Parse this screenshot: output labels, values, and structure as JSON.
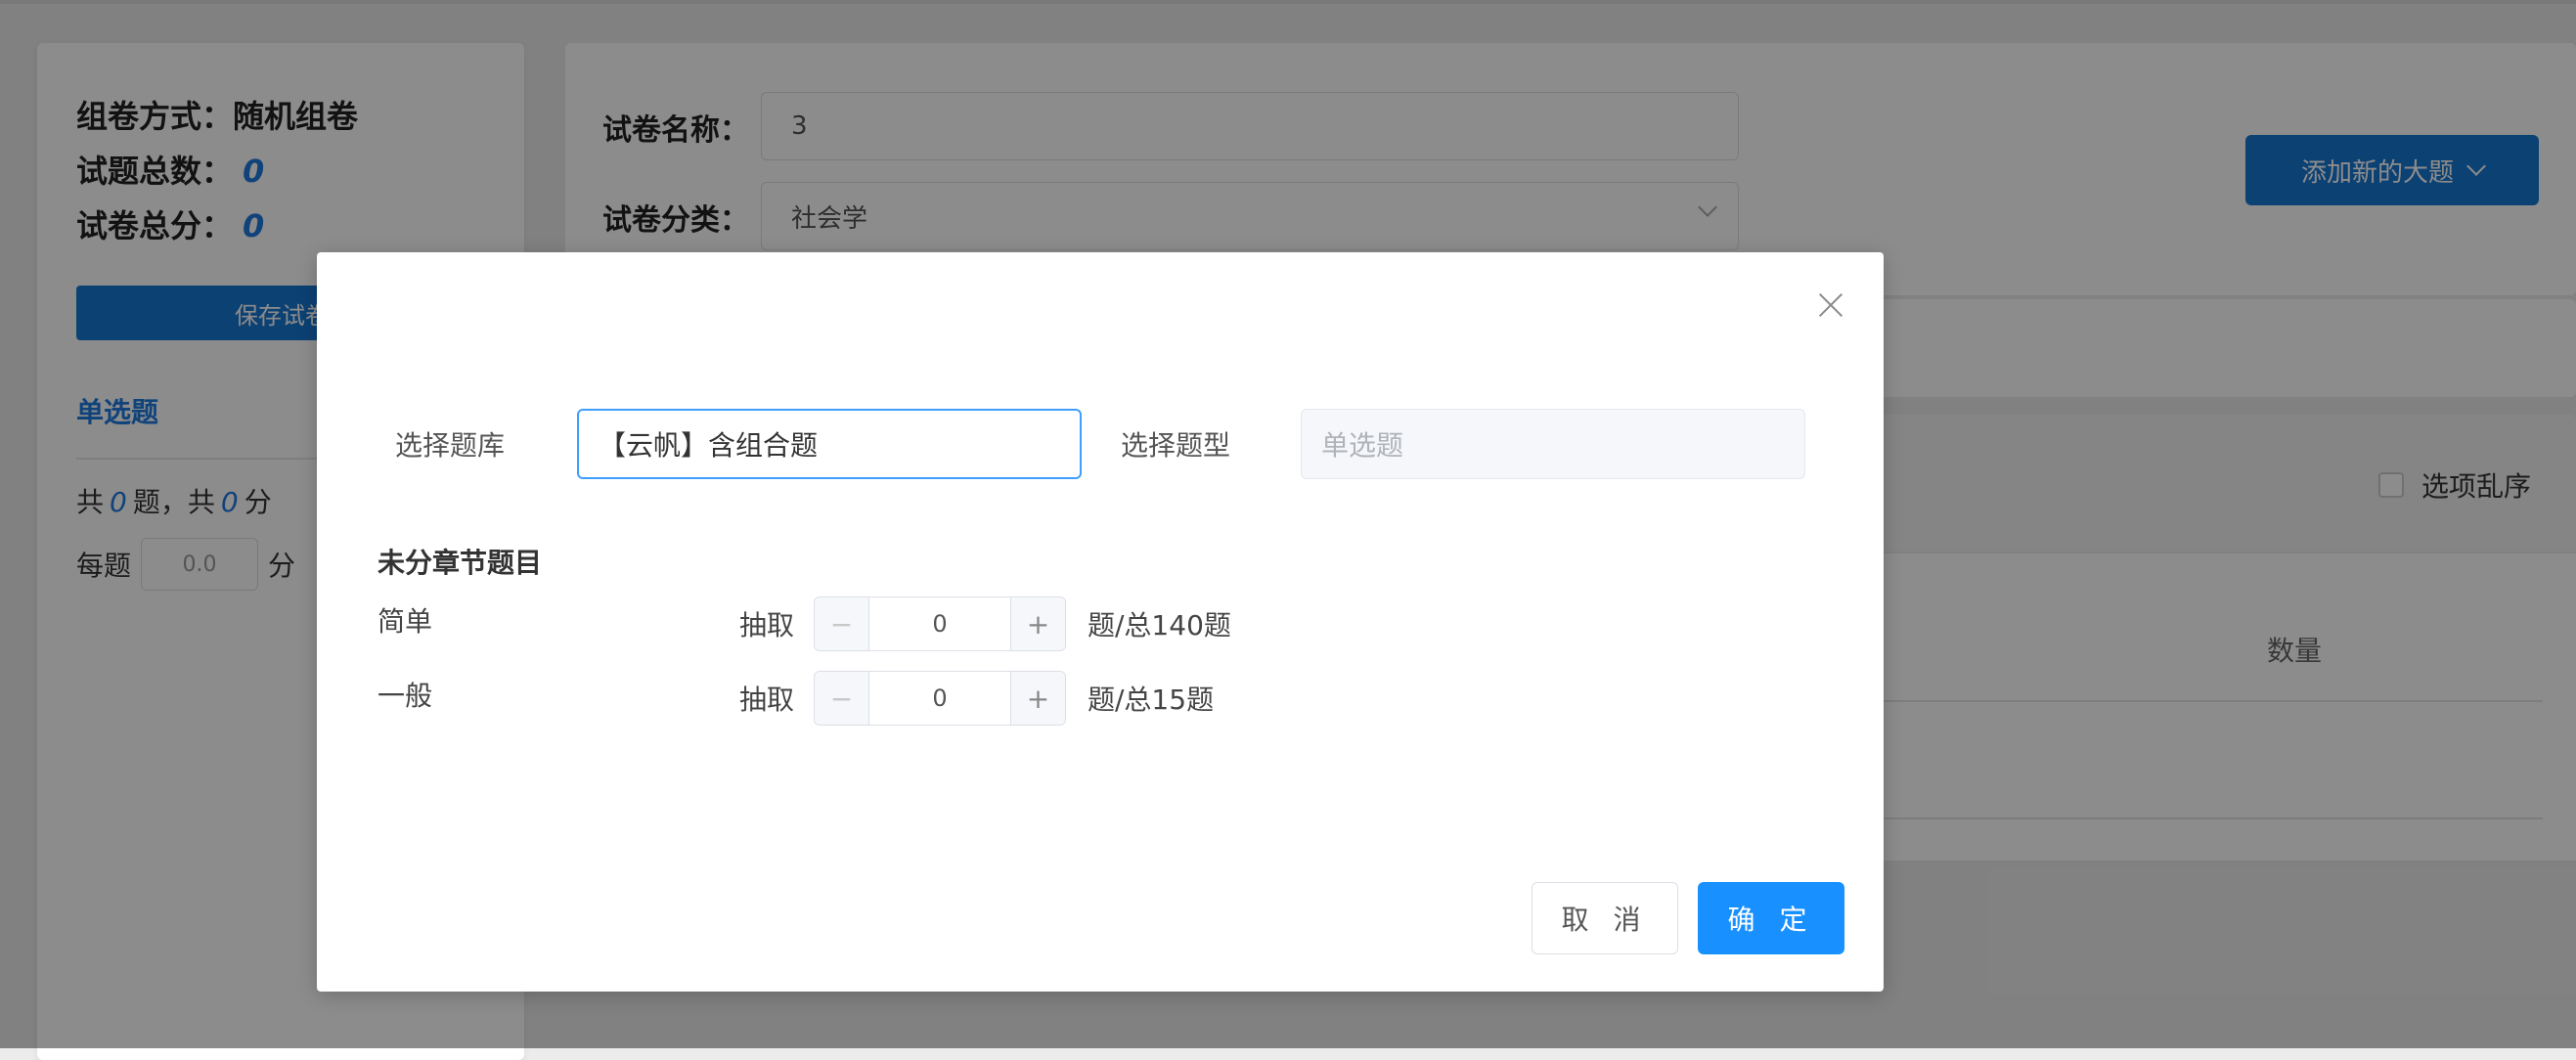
{
  "sidebar": {
    "mode_label": "组卷方式：",
    "mode_value": "随机组卷",
    "total_count_label": "试题总数：",
    "total_count_value": "0",
    "total_score_label": "试卷总分：",
    "total_score_value": "0",
    "save_button": "保存试卷",
    "qtype_title": "单选题",
    "count_prefix": "共",
    "count_q": "0",
    "count_mid": "题，共",
    "count_score": "0",
    "count_suffix": "分",
    "per_label": "每题",
    "per_value": "0.0",
    "per_suffix": "分"
  },
  "form": {
    "name_label": "试卷名称：",
    "name_value": "3",
    "category_label": "试卷分类：",
    "category_value": "社会学",
    "add_button": "添加新的大题"
  },
  "table": {
    "shuffle_label": "选项乱序",
    "col_quantity": "数量"
  },
  "dialog": {
    "bank_label": "选择题库",
    "bank_value": "【云帆】含组合题",
    "type_label": "选择题型",
    "type_placeholder": "单选题",
    "section_title": "未分章节题目",
    "rows": [
      {
        "level": "简单",
        "extract": "抽取",
        "value": "0",
        "total": "题/总140题"
      },
      {
        "level": "一般",
        "extract": "抽取",
        "value": "0",
        "total": "题/总15题"
      }
    ],
    "cancel_button": "取 消",
    "ok_button": "确 定"
  }
}
